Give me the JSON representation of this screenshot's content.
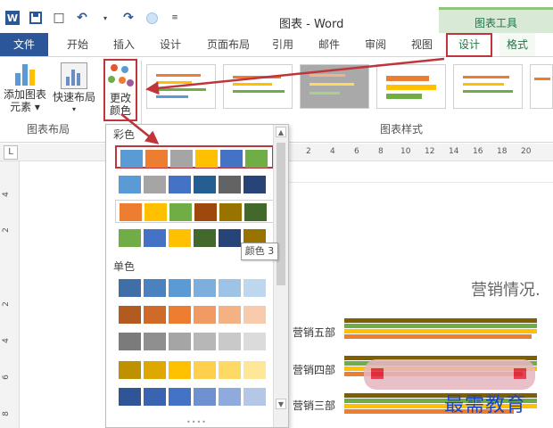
{
  "titlebar": {
    "title": "图表 - Word",
    "chart_tools": "图表工具"
  },
  "tabs": [
    "文件",
    "开始",
    "插入",
    "设计",
    "页面布局",
    "引用",
    "邮件",
    "审阅",
    "视图",
    "设计",
    "格式"
  ],
  "ribbon": {
    "add_element": [
      "添加图表",
      "元素 ▾"
    ],
    "quick_layout": [
      "快速布局",
      "▾"
    ],
    "change_colors": [
      "更改",
      "颜色"
    ],
    "group_layout": "图表布局",
    "group_styles": "图表样式"
  },
  "ruler": {
    "corner": "L",
    "ticks": [
      "2",
      "4",
      "6",
      "8",
      "10",
      "12",
      "14",
      "16",
      "18",
      "20"
    ],
    "vticks": [
      "4",
      "2",
      "2",
      "4",
      "6",
      "8"
    ]
  },
  "color_panel": {
    "colorful_header": "彩色",
    "mono_header": "单色",
    "tooltip": "颜色 3",
    "colorful_rows": [
      [
        "#5b9bd5",
        "#ed7d31",
        "#a5a5a5",
        "#ffc000",
        "#4472c4",
        "#70ad47"
      ],
      [
        "#5b9bd5",
        "#a5a5a5",
        "#4472c4",
        "#255e91",
        "#636363",
        "#264478"
      ],
      [
        "#ed7d31",
        "#ffc000",
        "#70ad47",
        "#9e480e",
        "#997300",
        "#43682b"
      ],
      [
        "#70ad47",
        "#4472c4",
        "#ffc000",
        "#43682b",
        "#264478",
        "#997300"
      ]
    ],
    "mono_rows": [
      [
        "#3f6fa6",
        "#4a82c0",
        "#5b9bd5",
        "#7cafdd",
        "#9dc3e6",
        "#bdd7ee"
      ],
      [
        "#b35a20",
        "#d06a29",
        "#ed7d31",
        "#f19a63",
        "#f4b183",
        "#f8cbad"
      ],
      [
        "#7b7b7b",
        "#8f8f8f",
        "#a5a5a5",
        "#b7b7b7",
        "#c9c9c9",
        "#dbdbdb"
      ],
      [
        "#bf9000",
        "#dfa800",
        "#ffc000",
        "#ffd04d",
        "#ffd966",
        "#ffe699"
      ],
      [
        "#2f5597",
        "#3a64b0",
        "#4472c4",
        "#6f91d0",
        "#8faadc",
        "#b4c7e7"
      ]
    ]
  },
  "chart": {
    "title": "营销情况.",
    "labels": [
      "营销五部",
      "营销四部",
      "营销三部"
    ]
  },
  "watermark": "最需教育",
  "colors": {
    "word_blue": "#2b579a",
    "chart_tools_green": "#217346",
    "highlight_red": "#c0353a"
  }
}
